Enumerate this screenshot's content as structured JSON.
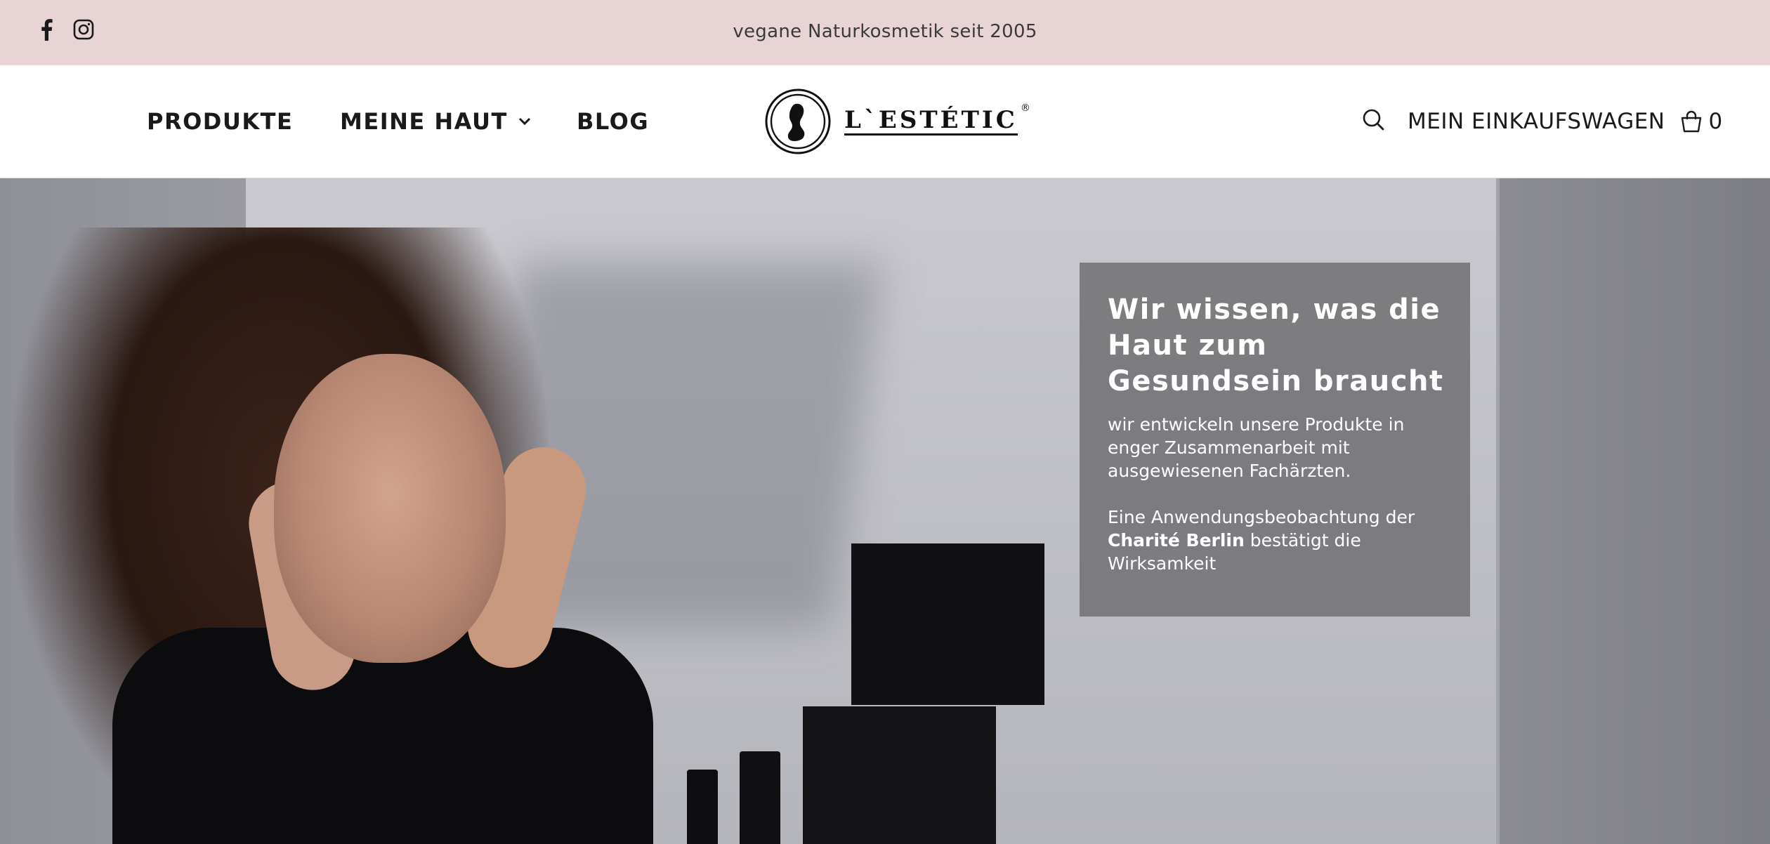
{
  "announcement": {
    "text": "vegane Naturkosmetik seit 2005"
  },
  "social": {
    "icons": [
      "facebook-icon",
      "instagram-icon"
    ]
  },
  "nav": {
    "items": [
      {
        "label": "PRODUKTE"
      },
      {
        "label": "MEINE HAUT",
        "has_dropdown": true
      },
      {
        "label": "BLOG"
      }
    ]
  },
  "logo": {
    "text": "L`ESTÉTIC",
    "registered": "®"
  },
  "header": {
    "cart_label": "MEIN EINKAUFSWAGEN",
    "cart_count": "0"
  },
  "hero": {
    "title": "Wir wissen, was die Haut zum Gesundsein braucht",
    "paragraph1": "wir entwickeln unsere Produkte in enger Zusammenarbeit mit ausgewiesenen Fachärzten.",
    "paragraph2_prefix": "Eine Anwendungsbeobachtung der",
    "paragraph2_bold": "Charité Berlin",
    "paragraph2_suffix": "bestätigt die Wirksamkeit"
  },
  "colors": {
    "topbar": "#e8d4d5",
    "overlay": "#76767a",
    "text_dark": "#1a1a1a"
  }
}
